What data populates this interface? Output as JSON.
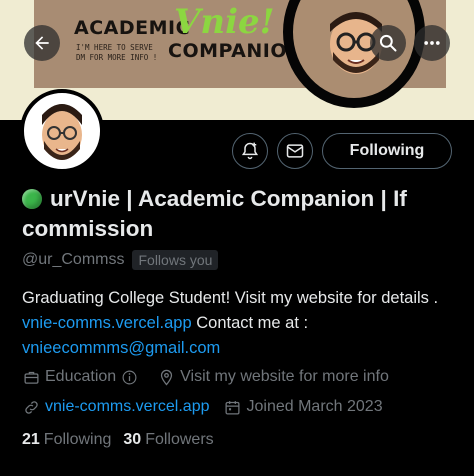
{
  "banner": {
    "title_a": "ACADEMIC",
    "script": "Vnie!",
    "title_b": "COMPANION",
    "tagline_1": "I'M HERE TO SERVE",
    "tagline_2": "DM FOR MORE INFO !"
  },
  "profile": {
    "name": "urVnie | Academic Companion | If commission",
    "handle": "@ur_Commss",
    "follows_you": "Follows you",
    "bio_text_1": "Graduating College Student! Visit my website for details . ",
    "bio_link_1": "vnie-comms.vercel.app",
    "bio_text_2": " Contact me at : ",
    "bio_link_2": "vnieecommms@gmail.com",
    "category": "Education",
    "location": "Visit my website for more info",
    "website": "vnie-comms.vercel.app",
    "joined": "Joined March 2023",
    "following_count": "21",
    "following_label": "Following",
    "followers_count": "30",
    "followers_label": "Followers"
  },
  "actions": {
    "following_button": "Following"
  },
  "icons": {
    "back": "back-arrow-icon",
    "search": "search-icon",
    "more": "more-icon",
    "notify": "bell-plus-icon",
    "message": "mail-icon",
    "category": "briefcase-icon",
    "info": "info-icon",
    "location": "location-pin-icon",
    "website": "link-icon",
    "joined": "calendar-icon"
  },
  "colors": {
    "link": "#1d9bf0",
    "muted": "#71767b",
    "text": "#e7e9ea",
    "status_dot": "#3bb54a"
  }
}
